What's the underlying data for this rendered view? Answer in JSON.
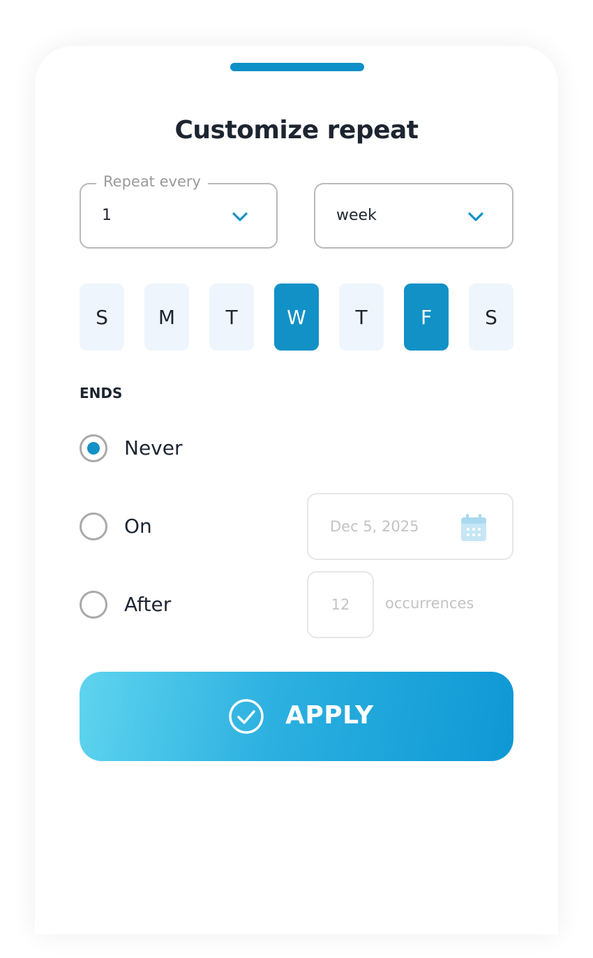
{
  "dialog": {
    "title": "Customize repeat"
  },
  "repeat": {
    "legend": "Repeat every",
    "interval_value": "1",
    "unit_value": "week"
  },
  "days": [
    {
      "label": "S",
      "selected": false
    },
    {
      "label": "M",
      "selected": false
    },
    {
      "label": "T",
      "selected": false
    },
    {
      "label": "W",
      "selected": true
    },
    {
      "label": "T",
      "selected": false
    },
    {
      "label": "F",
      "selected": true
    },
    {
      "label": "S",
      "selected": false
    }
  ],
  "ends": {
    "heading": "ENDS",
    "options": [
      {
        "label": "Never",
        "checked": true
      },
      {
        "label": "On",
        "checked": false
      },
      {
        "label": "After",
        "checked": false
      }
    ],
    "date_placeholder": "Dec 5, 2025",
    "occurrences_value": "12",
    "occurrences_label": "occurrences"
  },
  "apply_button": {
    "label": "APPLY"
  },
  "colors": {
    "accent": "#1191c6",
    "day_inactive_bg": "#eff5fc",
    "text_dark": "#1d2530",
    "disabled_text": "#c3c3c3"
  },
  "icons": {
    "interval_dropdown": "chevron-down-icon",
    "unit_dropdown": "chevron-down-icon",
    "date_picker": "calendar-icon",
    "apply": "check-circle-icon"
  }
}
